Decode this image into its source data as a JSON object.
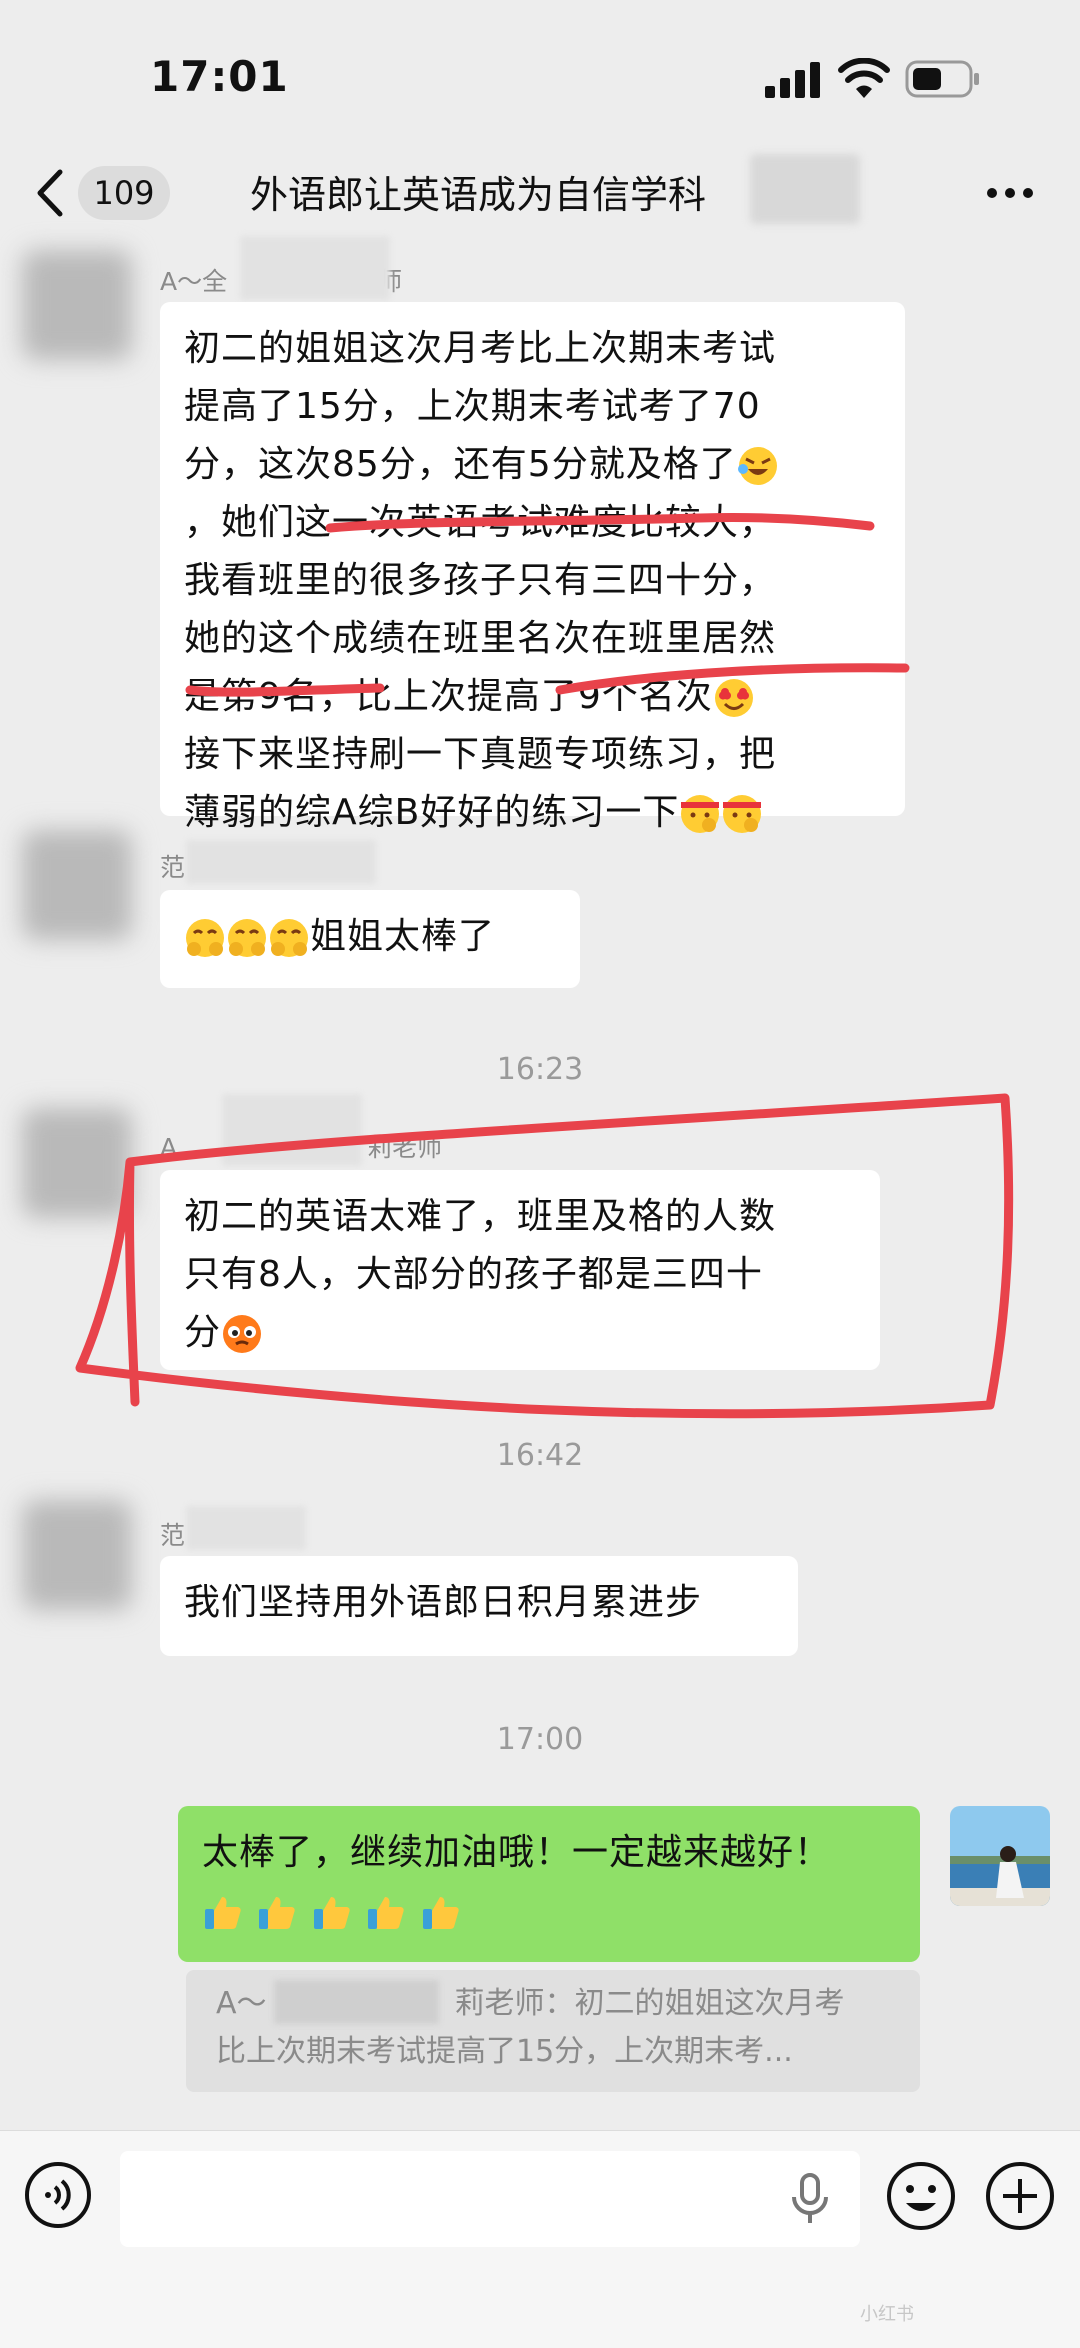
{
  "status_bar": {
    "time": "17:01"
  },
  "nav": {
    "unread_count": "109",
    "title": "外语郎让英语成为自信学科"
  },
  "messages": [
    {
      "sender": "A～全",
      "sender_suffix": "师",
      "lines": [
        "初二的姐姐这次月考比上次期末考试",
        "提高了15分，上次期末考试考了70",
        "分，这次85分，还有5分就及格了",
        "，她们这一次英语考试难度比较大，",
        "我看班里的很多孩子只有三四十分，",
        "她的这个成绩在班里名次在班里居然",
        "是第9名，比上次提高了9个名次",
        "接下来坚持刷一下真题专项练习，把",
        "薄弱的综A综B好好的练习一下"
      ]
    },
    {
      "sender": "范",
      "text": "姐姐太棒了"
    },
    {
      "timestamp": "16:23"
    },
    {
      "sender": "A",
      "sender_suffix": "莉老师",
      "lines": [
        "初二的英语太难了，班里及格的人数",
        "只有8人，大部分的孩子都是三四十",
        "分"
      ]
    },
    {
      "timestamp": "16:42"
    },
    {
      "sender": "范",
      "text": "我们坚持用外语郎日积月累进步"
    },
    {
      "timestamp": "17:00"
    },
    {
      "self": true,
      "lines": [
        "太棒了，继续加油哦！一定越来越好！"
      ],
      "quote_line1_a": "A～",
      "quote_line1_b": "莉老师：初二的姐姐这次月考",
      "quote_line2": "比上次期末考试提高了15分，上次期末考..."
    }
  ],
  "icons": {
    "back": "chevron-left-icon",
    "more": "more-dots-icon",
    "voice": "voice-icon",
    "mic": "mic-icon",
    "emoji": "smile-icon",
    "plus": "plus-icon"
  },
  "colors": {
    "accent_green": "#8fe068",
    "annotation_red": "#e8434b"
  },
  "watermark": "小红书"
}
